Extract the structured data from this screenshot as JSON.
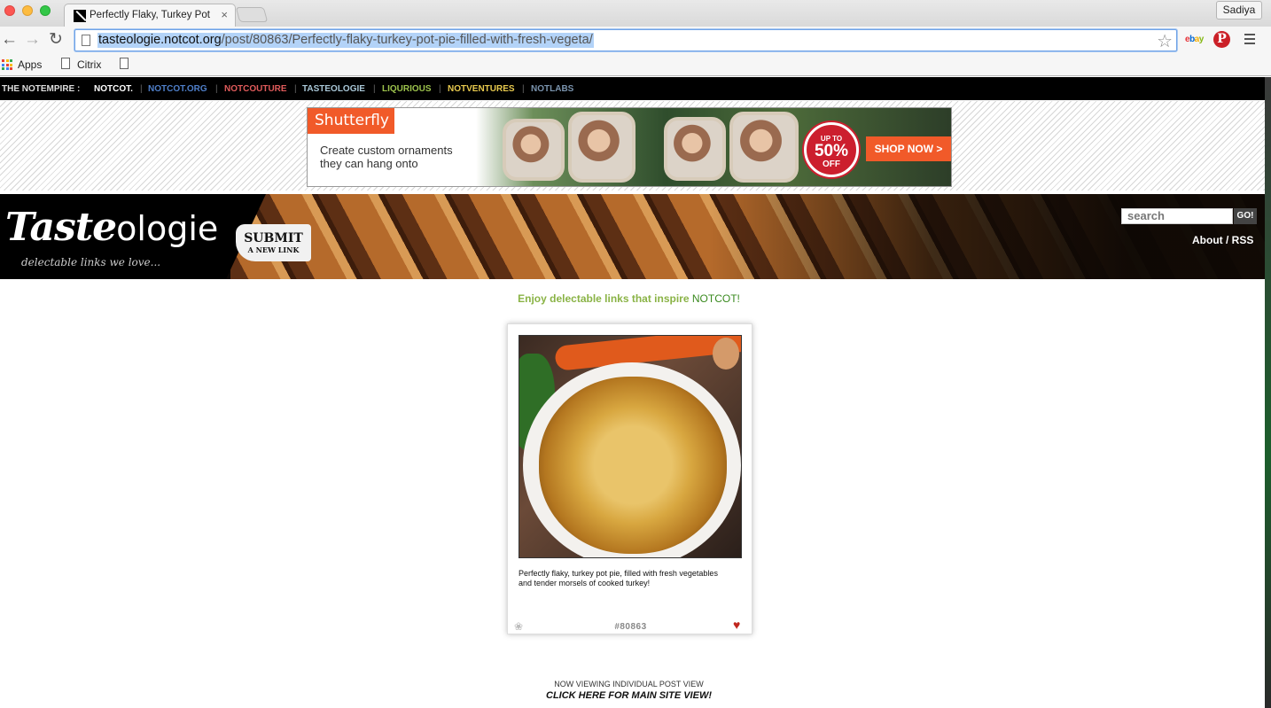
{
  "browser": {
    "tab_title": "Perfectly Flaky, Turkey Pot",
    "tab_close": "×",
    "profile_name": "Sadiya",
    "url_host": "tasteologie.notcot.org",
    "url_path": "/post/80863/Perfectly-flaky-turkey-pot-pie-filled-with-fresh-vegeta/",
    "back_icon": "←",
    "forward_icon": "→",
    "reload_icon": "↻",
    "star_icon": "☆",
    "ebay_letters": [
      "e",
      "b",
      "a",
      "y"
    ],
    "pinterest_letter": "P",
    "bookmarks": [
      {
        "label": "Apps",
        "icon": "apps-grid-icon"
      },
      {
        "label": "Citrix",
        "icon": "page-icon"
      },
      {
        "label": "",
        "icon": "page-icon"
      }
    ]
  },
  "empire_bar": {
    "intro": "THE NOTEMPIRE :",
    "items": [
      {
        "label": "NOTCOT.",
        "color": "#ffffff"
      },
      {
        "label": "NOTCOT.ORG",
        "color": "#4f7fc9"
      },
      {
        "label": "NOTCOUTURE",
        "color": "#e05b5b"
      },
      {
        "label": "TASTEOLOGIE",
        "color": "#a8c6d6"
      },
      {
        "label": "LIQURIOUS",
        "color": "#9cc24c"
      },
      {
        "label": "NOTVENTURES",
        "color": "#e7c94e"
      },
      {
        "label": "NOTLABS",
        "color": "#7a93ad"
      }
    ],
    "separator": "|"
  },
  "ad": {
    "brand": "Shutterfly",
    "copy_line1": "Create custom ornaments",
    "copy_line2": "they can hang onto",
    "badge_up": "UP TO",
    "badge_pct": "50%",
    "badge_off": "OFF",
    "cta": "SHOP NOW >"
  },
  "header": {
    "logo_bold": "Taste",
    "logo_light": "ologie",
    "tagline": "delectable links we love...",
    "submit_main": "SUBMIT",
    "submit_sub": "A NEW LINK",
    "search_placeholder": "search",
    "go_label": "GO!",
    "about_rss": "About / RSS"
  },
  "main": {
    "enjoy_text": "Enjoy delectable links that inspire",
    "enjoy_brand": "NOTCOT!",
    "post": {
      "caption": "Perfectly flaky, turkey pot pie, filled with fresh vegetables and tender morsels of cooked turkey!",
      "post_id": "#80863",
      "heart_icon": "♥",
      "paw_icon": "❀"
    },
    "viewing_label": "NOW VIEWING INDIVIDUAL POST VIEW",
    "main_site_link": "CLICK HERE FOR MAIN SITE VIEW!"
  }
}
